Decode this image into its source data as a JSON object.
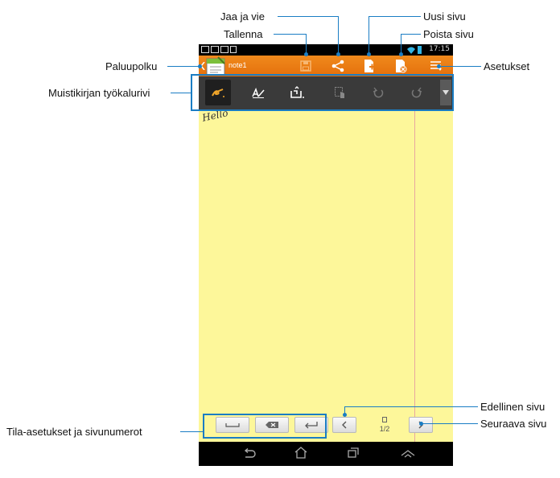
{
  "callouts": {
    "share_export": "Jaa ja vie",
    "new_page": "Uusi sivu",
    "save": "Tallenna",
    "delete_page": "Poista sivu",
    "return_path": "Paluupolku",
    "settings": "Asetukset",
    "notebook_toolbar": "Muistikirjan työkalurivi",
    "previous_page": "Edellinen sivu",
    "next_page": "Seuraava sivu",
    "mode_settings": "Tila-asetukset ja sivunumerot"
  },
  "status_bar": {
    "time": "17:15"
  },
  "app_bar": {
    "note_title": "note1"
  },
  "note": {
    "handwriting": "Hello"
  },
  "page_indicator": "1/2",
  "colors": {
    "accent": "#1a7dc4",
    "appbar": "#e97a14",
    "note": "#fdf79a"
  }
}
